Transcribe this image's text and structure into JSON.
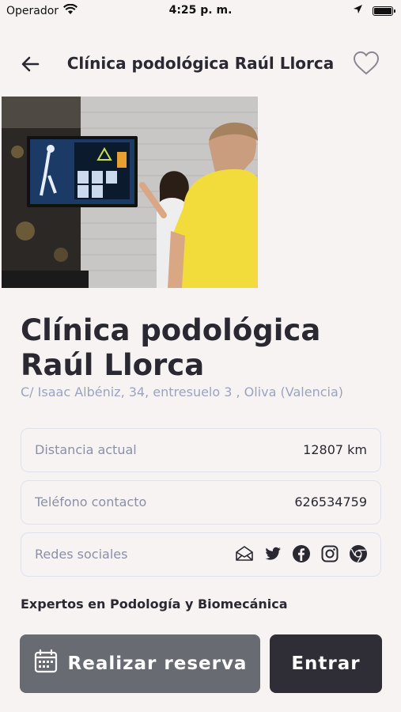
{
  "status_bar": {
    "carrier": "Operador",
    "time": "4:25 p. m."
  },
  "nav": {
    "title": "Clínica podológica Raúl Llorca"
  },
  "clinic": {
    "name": "Clínica podológica Raúl Llorca",
    "address": "C/ Isaac Albéniz, 34, entresuelo 3 , Oliva (Valencia)",
    "tagline": "Expertos en Podología y Biomecánica"
  },
  "info": {
    "distance_label": "Distancia actual",
    "distance_value": "12807 km",
    "phone_label": "Teléfono contacto",
    "phone_value": "626534759",
    "social_label": "Redes sociales",
    "social_icons": [
      "mail-icon",
      "twitter-icon",
      "facebook-icon",
      "instagram-icon",
      "chrome-icon"
    ]
  },
  "actions": {
    "reserve_label": "Realizar reserva",
    "enter_label": "Entrar"
  },
  "colors": {
    "background": "#f7f3f3",
    "reserve_button": "#686b72",
    "enter_button": "#2f2d36",
    "address": "#9aa3c2"
  }
}
